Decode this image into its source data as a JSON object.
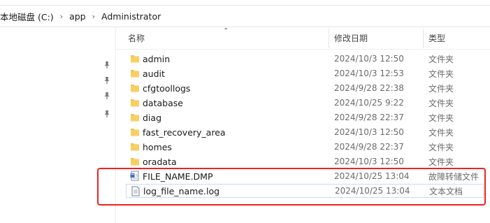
{
  "breadcrumb": {
    "items": [
      "本地磁盘 (C:)",
      "app",
      "Administrator"
    ]
  },
  "columns": {
    "name": "名称",
    "modified": "修改日期",
    "type": "类型"
  },
  "files": [
    {
      "name": "admin",
      "modified": "2024/10/3 12:50",
      "type": "文件夹",
      "kind": "folder"
    },
    {
      "name": "audit",
      "modified": "2024/10/3 12:53",
      "type": "文件夹",
      "kind": "folder"
    },
    {
      "name": "cfgtoollogs",
      "modified": "2024/9/28 22:38",
      "type": "文件夹",
      "kind": "folder"
    },
    {
      "name": "database",
      "modified": "2024/10/25 9:22",
      "type": "文件夹",
      "kind": "folder"
    },
    {
      "name": "diag",
      "modified": "2024/9/28 22:37",
      "type": "文件夹",
      "kind": "folder"
    },
    {
      "name": "fast_recovery_area",
      "modified": "2024/10/3 12:50",
      "type": "文件夹",
      "kind": "folder"
    },
    {
      "name": "homes",
      "modified": "2024/9/28 22:37",
      "type": "文件夹",
      "kind": "folder"
    },
    {
      "name": "oradata",
      "modified": "2024/10/3 12:50",
      "type": "文件夹",
      "kind": "folder"
    },
    {
      "name": "FILE_NAME.DMP",
      "modified": "2024/10/25 13:04",
      "type": "故障转储文件",
      "kind": "dump-file"
    },
    {
      "name": "log_file_name.log",
      "modified": "2024/10/25 13:04",
      "type": "文本文档",
      "kind": "text-file"
    }
  ],
  "colors": {
    "folder": "#f2c14e",
    "highlight": "#ee2222",
    "selection_border": "#c8dcf0"
  }
}
